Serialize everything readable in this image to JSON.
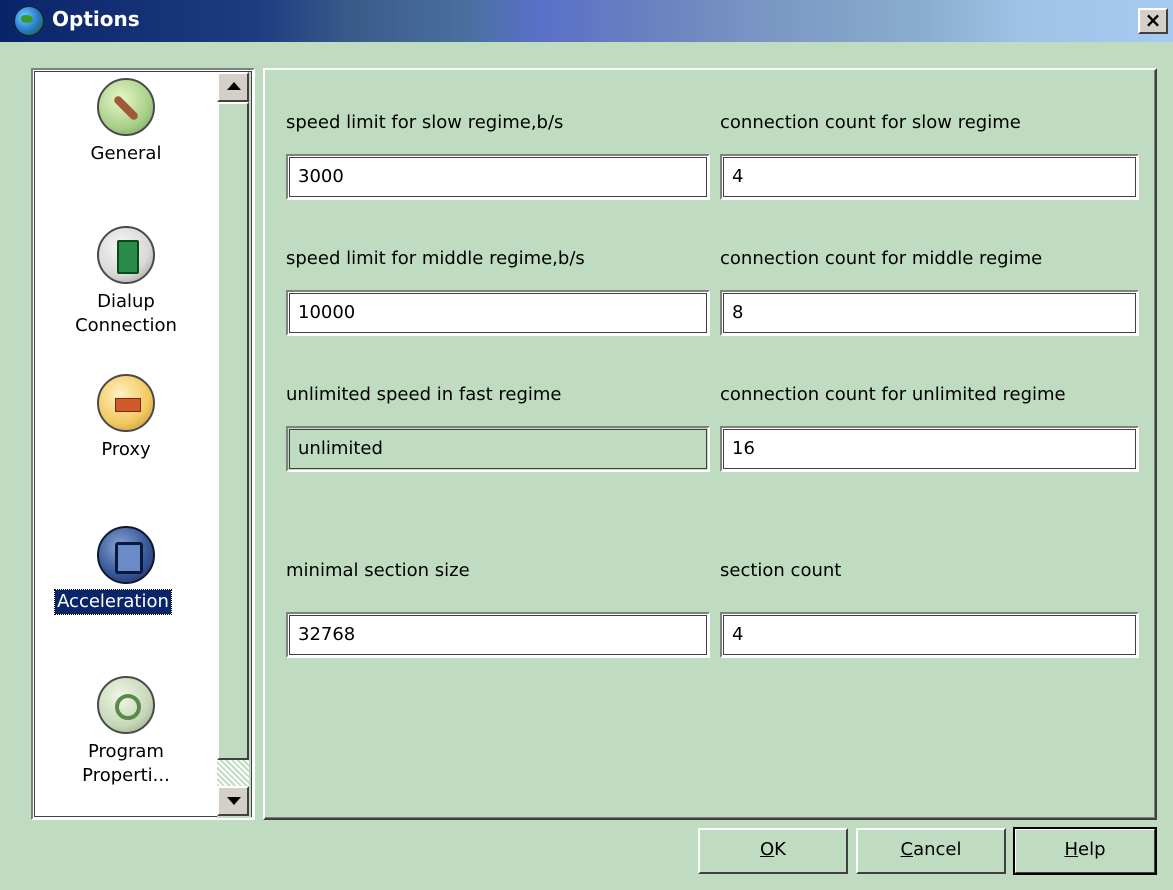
{
  "window": {
    "title": "Options",
    "close_symbol": "×"
  },
  "sidebar": {
    "items": [
      {
        "label_lines": [
          "General"
        ],
        "icon": "general-icon"
      },
      {
        "label_lines": [
          "Dialup",
          "Connection"
        ],
        "icon": "dialup-icon"
      },
      {
        "label_lines": [
          "Proxy"
        ],
        "icon": "proxy-icon"
      },
      {
        "label_lines": [
          "Acceleration"
        ],
        "icon": "acceleration-icon",
        "selected": true
      },
      {
        "label_lines": [
          "Program",
          "Properti..."
        ],
        "icon": "program-properties-icon"
      }
    ]
  },
  "fields": {
    "slow_speed": {
      "label": "speed limit for slow regime,b/s",
      "value": "3000"
    },
    "slow_count": {
      "label": "connection count for slow regime",
      "value": "4"
    },
    "middle_speed": {
      "label": "speed limit for middle regime,b/s",
      "value": "10000"
    },
    "middle_count": {
      "label": "connection count for middle regime",
      "value": "8"
    },
    "fast_speed": {
      "label": "unlimited speed in fast regime",
      "value": "unlimited"
    },
    "fast_count": {
      "label": "connection count for unlimited regime",
      "value": "16"
    },
    "section_size": {
      "label": "minimal section size",
      "value": "32768"
    },
    "section_count": {
      "label": "section count",
      "value": "4"
    }
  },
  "buttons": {
    "ok": {
      "mnemonic": "O",
      "rest": "K"
    },
    "cancel": {
      "mnemonic": "C",
      "rest": "ancel"
    },
    "help": {
      "mnemonic": "H",
      "rest": "elp"
    }
  },
  "colors": {
    "background": "#c0dcc0",
    "selection": "#0a246a",
    "title_start": "#0a246a",
    "title_end": "#a6caf0"
  }
}
